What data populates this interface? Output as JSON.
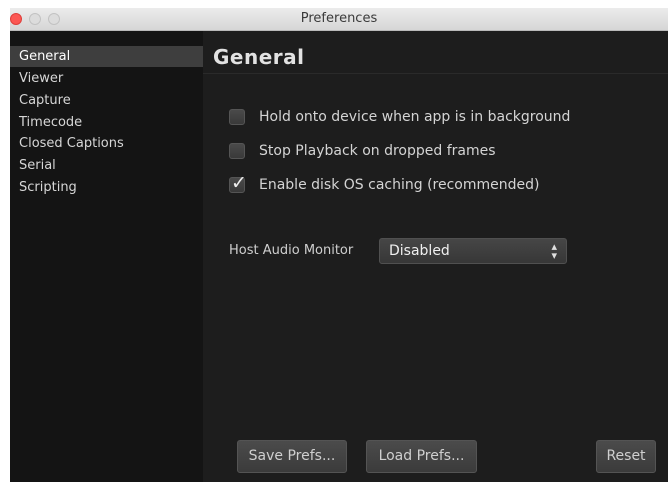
{
  "window": {
    "title": "Preferences"
  },
  "sidebar": {
    "items": [
      {
        "label": "General",
        "selected": true
      },
      {
        "label": "Viewer",
        "selected": false
      },
      {
        "label": "Capture",
        "selected": false
      },
      {
        "label": "Timecode",
        "selected": false
      },
      {
        "label": "Closed Captions",
        "selected": false
      },
      {
        "label": "Serial",
        "selected": false
      },
      {
        "label": "Scripting",
        "selected": false
      }
    ]
  },
  "main": {
    "title": "General",
    "options": [
      {
        "label": "Hold onto device when app is in background",
        "checked": false
      },
      {
        "label": "Stop Playback on dropped frames",
        "checked": false
      },
      {
        "label": "Enable disk OS caching (recommended)",
        "checked": true
      }
    ],
    "audio_monitor": {
      "label": "Host Audio Monitor",
      "value": "Disabled"
    },
    "buttons": {
      "save": "Save Prefs...",
      "load": "Load Prefs...",
      "reset": "Reset"
    }
  },
  "icons": {
    "checkmark": "✓",
    "select_arrows": "up-down-chevron-icon"
  },
  "colors": {
    "background": "#1d1d1d",
    "sidebar": "#141414",
    "selected": "#3e3e3e",
    "close_button": "#fc5753"
  }
}
